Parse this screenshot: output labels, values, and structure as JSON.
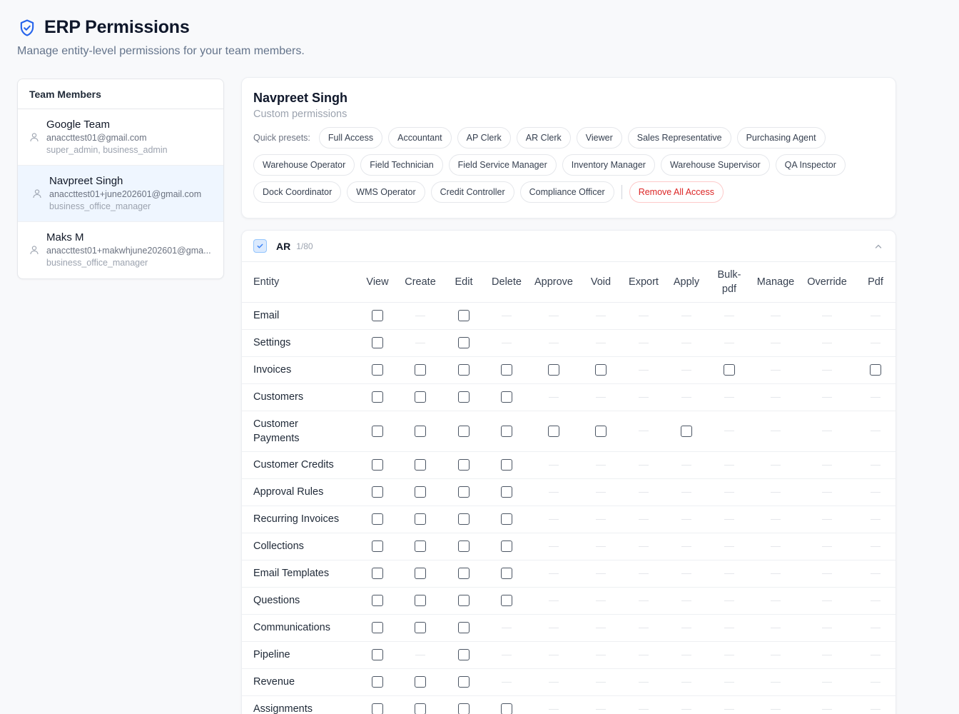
{
  "header": {
    "title": "ERP Permissions",
    "subtitle": "Manage entity-level permissions for your team members."
  },
  "icons": {
    "title": "shield-check-icon",
    "member": "user-icon",
    "collapse": "chevron-up-icon",
    "module_check": "check-icon"
  },
  "colors": {
    "accent": "#2563eb",
    "danger": "#dc2626",
    "selected_bg": "#eff6ff"
  },
  "members": {
    "heading": "Team Members",
    "items": [
      {
        "name": "Google Team",
        "email": "anaccttest01@gmail.com",
        "roles": "super_admin, business_admin",
        "selected": false
      },
      {
        "name": "Navpreet Singh",
        "email": "anaccttest01+june202601@gmail.com",
        "roles": "business_office_manager",
        "selected": true
      },
      {
        "name": "Maks M",
        "email": "anaccttest01+makwhjune202601@gma...",
        "roles": "business_office_manager",
        "selected": false
      }
    ]
  },
  "user": {
    "name": "Navpreet Singh",
    "permission_mode": "Custom permissions",
    "presets_label": "Quick presets:",
    "presets": [
      "Full Access",
      "Accountant",
      "AP Clerk",
      "AR Clerk",
      "Viewer",
      "Sales Representative",
      "Purchasing Agent",
      "Warehouse Operator",
      "Field Technician",
      "Field Service Manager",
      "Inventory Manager",
      "Warehouse Supervisor",
      "QA Inspector",
      "Dock Coordinator",
      "WMS Operator",
      "Credit Controller",
      "Compliance Officer"
    ],
    "remove_all": "Remove All Access"
  },
  "module": {
    "name": "AR",
    "count": "1/80",
    "checked": true,
    "columns": [
      "Entity",
      "View",
      "Create",
      "Edit",
      "Delete",
      "Approve",
      "Void",
      "Export",
      "Apply",
      "Bulk-\npdf",
      "Manage",
      "Override",
      "Pdf"
    ],
    "rows": [
      {
        "entity": "Email",
        "cells": [
          1,
          0,
          1,
          0,
          0,
          0,
          0,
          0,
          0,
          0,
          0,
          0
        ]
      },
      {
        "entity": "Settings",
        "cells": [
          1,
          0,
          1,
          0,
          0,
          0,
          0,
          0,
          0,
          0,
          0,
          0
        ]
      },
      {
        "entity": "Invoices",
        "cells": [
          1,
          1,
          1,
          1,
          1,
          1,
          0,
          0,
          1,
          0,
          0,
          1
        ]
      },
      {
        "entity": "Customers",
        "cells": [
          1,
          1,
          1,
          1,
          0,
          0,
          0,
          0,
          0,
          0,
          0,
          0
        ]
      },
      {
        "entity": "Customer\nPayments",
        "cells": [
          1,
          1,
          1,
          1,
          1,
          1,
          0,
          1,
          0,
          0,
          0,
          0
        ],
        "tall": true
      },
      {
        "entity": "Customer Credits",
        "cells": [
          1,
          1,
          1,
          1,
          0,
          0,
          0,
          0,
          0,
          0,
          0,
          0
        ]
      },
      {
        "entity": "Approval Rules",
        "cells": [
          1,
          1,
          1,
          1,
          0,
          0,
          0,
          0,
          0,
          0,
          0,
          0
        ]
      },
      {
        "entity": "Recurring Invoices",
        "cells": [
          1,
          1,
          1,
          1,
          0,
          0,
          0,
          0,
          0,
          0,
          0,
          0
        ]
      },
      {
        "entity": "Collections",
        "cells": [
          1,
          1,
          1,
          1,
          0,
          0,
          0,
          0,
          0,
          0,
          0,
          0
        ]
      },
      {
        "entity": "Email Templates",
        "cells": [
          1,
          1,
          1,
          1,
          0,
          0,
          0,
          0,
          0,
          0,
          0,
          0
        ]
      },
      {
        "entity": "Questions",
        "cells": [
          1,
          1,
          1,
          1,
          0,
          0,
          0,
          0,
          0,
          0,
          0,
          0
        ]
      },
      {
        "entity": "Communications",
        "cells": [
          1,
          1,
          1,
          0,
          0,
          0,
          0,
          0,
          0,
          0,
          0,
          0
        ]
      },
      {
        "entity": "Pipeline",
        "cells": [
          1,
          0,
          1,
          0,
          0,
          0,
          0,
          0,
          0,
          0,
          0,
          0
        ]
      },
      {
        "entity": "Revenue",
        "cells": [
          1,
          1,
          1,
          0,
          0,
          0,
          0,
          0,
          0,
          0,
          0,
          0
        ]
      },
      {
        "entity": "Assignments",
        "cells": [
          1,
          1,
          1,
          1,
          0,
          0,
          0,
          0,
          0,
          0,
          0,
          0
        ]
      }
    ]
  }
}
